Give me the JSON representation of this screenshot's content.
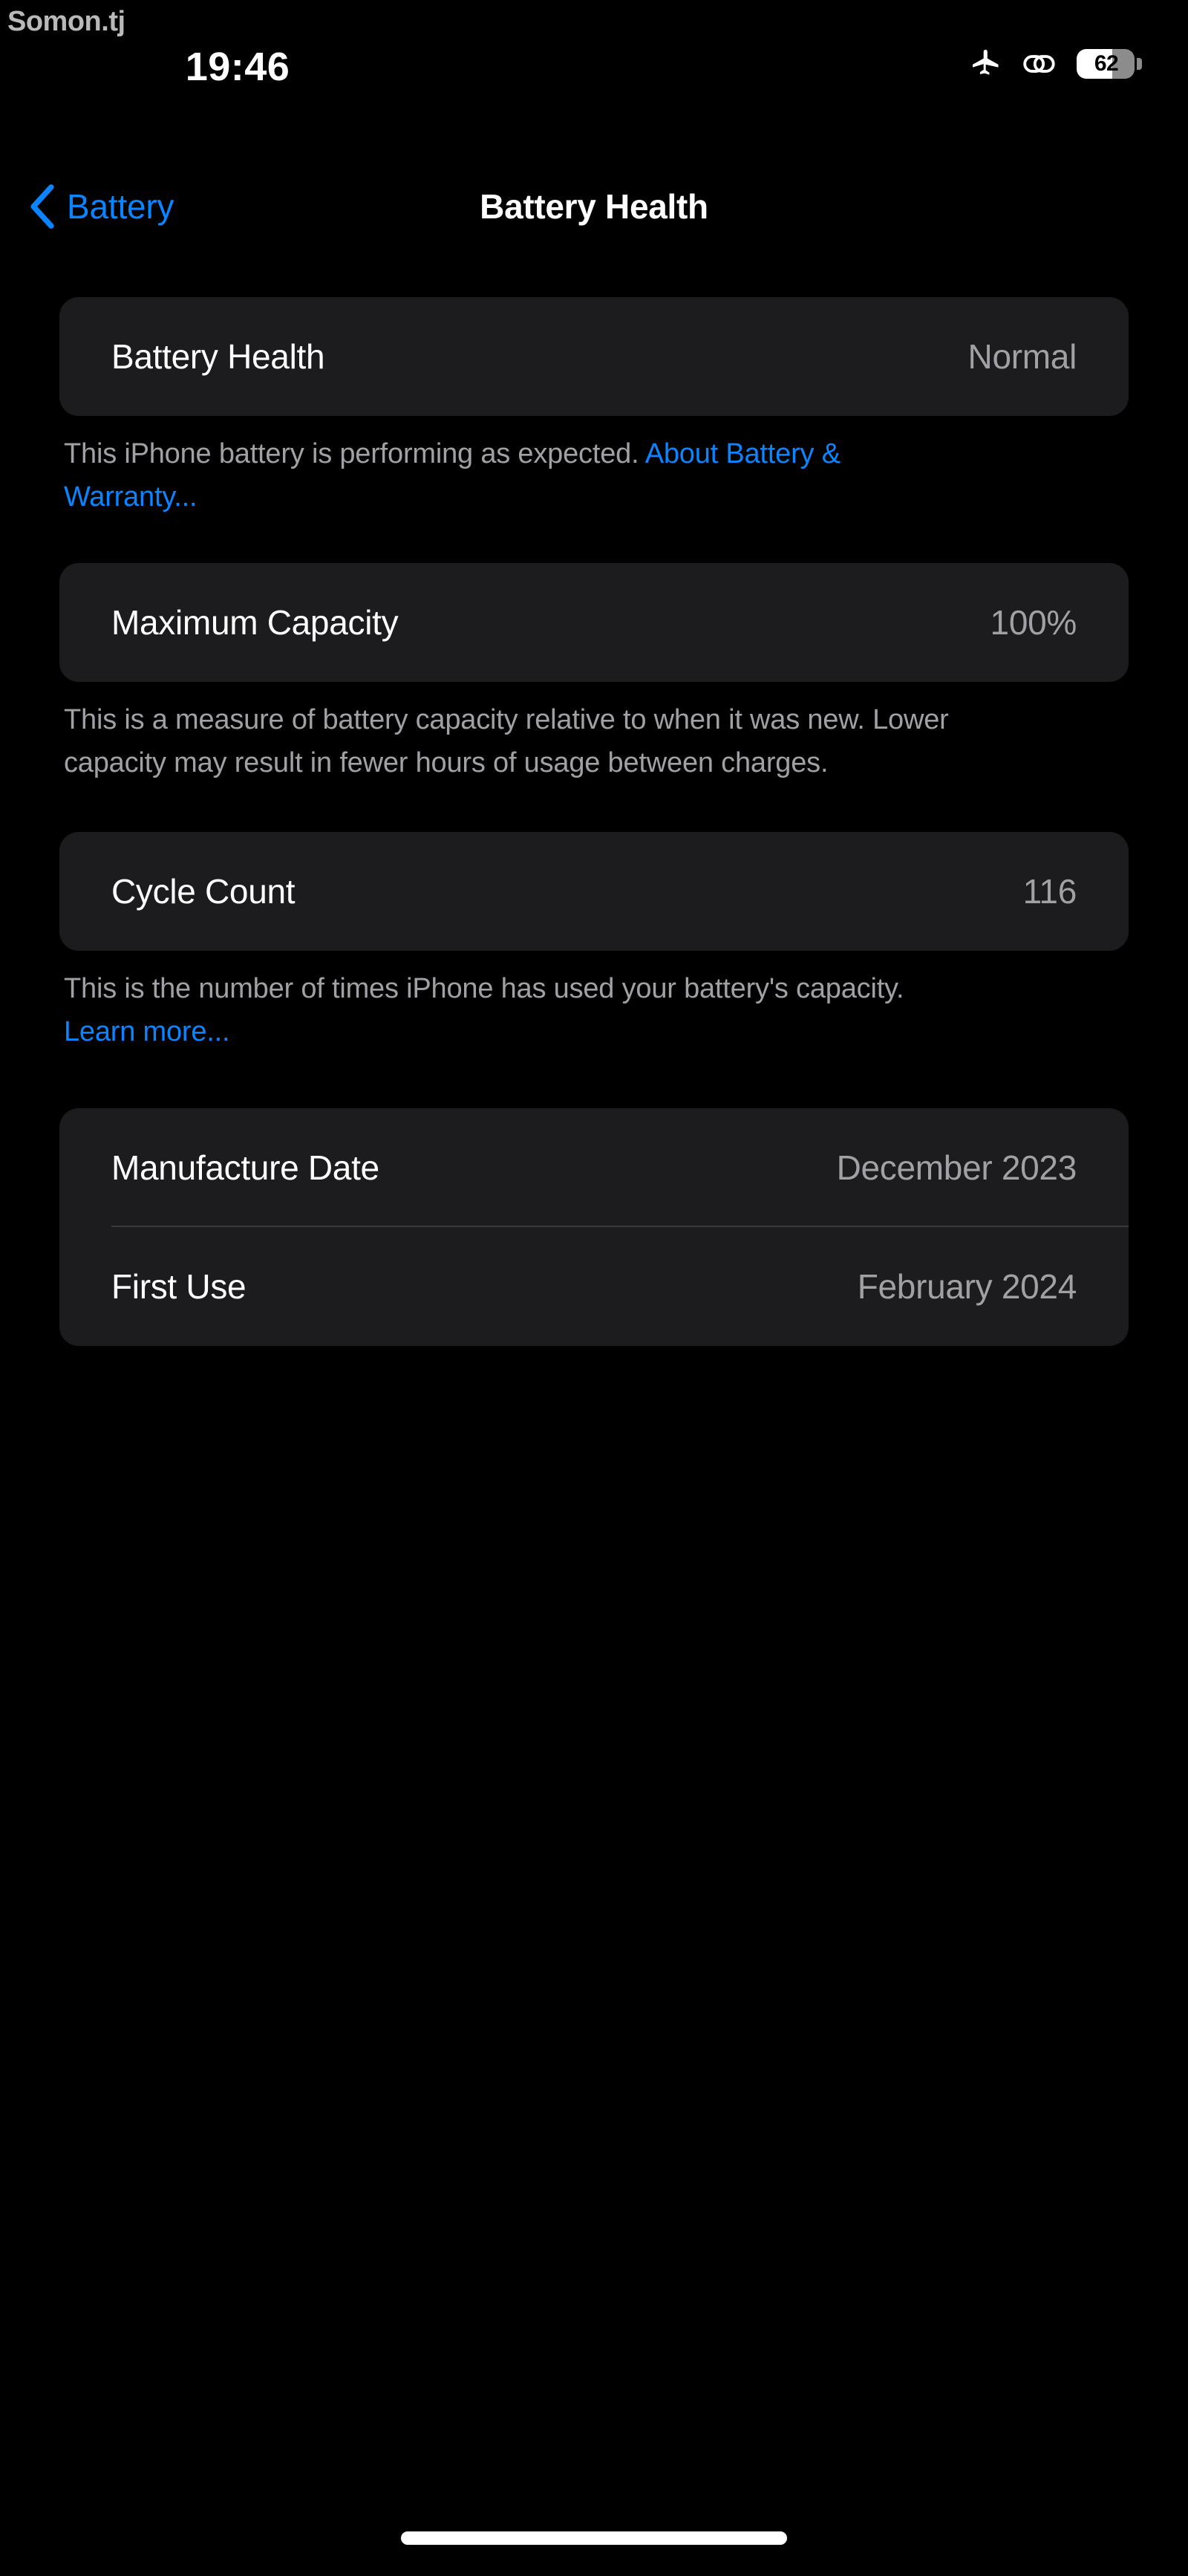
{
  "watermark": "Somon.tj",
  "status_bar": {
    "time": "19:46",
    "airplane_icon": "airplane-icon",
    "link_icon": "link-icon",
    "battery_percent": "62",
    "battery_level": 62
  },
  "nav": {
    "back_label": "Battery",
    "back_icon": "chevron-left-icon",
    "title": "Battery Health"
  },
  "accent_color": "#0a84ff",
  "sections": [
    {
      "rows": [
        {
          "label": "Battery Health",
          "value": "Normal"
        }
      ],
      "footnote_text": "This iPhone battery is performing as expected. ",
      "footnote_link": "About Battery & Warranty..."
    },
    {
      "rows": [
        {
          "label": "Maximum Capacity",
          "value": "100%"
        }
      ],
      "footnote_text": "This is a measure of battery capacity relative to when it was new. Lower capacity may result in fewer hours of usage between charges.",
      "footnote_link": ""
    },
    {
      "rows": [
        {
          "label": "Cycle Count",
          "value": "116"
        }
      ],
      "footnote_text": "This is the number of times iPhone has used your battery's capacity. ",
      "footnote_link": "Learn more..."
    },
    {
      "rows": [
        {
          "label": "Manufacture Date",
          "value": "December 2023"
        },
        {
          "label": "First Use",
          "value": "February 2024"
        }
      ],
      "footnote_text": "",
      "footnote_link": ""
    }
  ]
}
